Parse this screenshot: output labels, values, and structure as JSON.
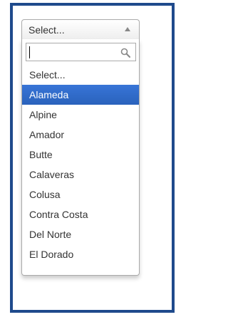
{
  "select": {
    "selected_label": "Select...",
    "options": [
      "Select...",
      "Alameda",
      "Alpine",
      "Amador",
      "Butte",
      "Calaveras",
      "Colusa",
      "Contra Costa",
      "Del Norte",
      "El Dorado"
    ],
    "highlighted_option": "Alameda",
    "search_value": ""
  },
  "colors": {
    "frame_border": "#1f4a8c",
    "highlight": "#3875d7",
    "text": "#333333"
  },
  "icons": {
    "trigger_arrow": "caret-up-icon",
    "search": "search-icon"
  }
}
